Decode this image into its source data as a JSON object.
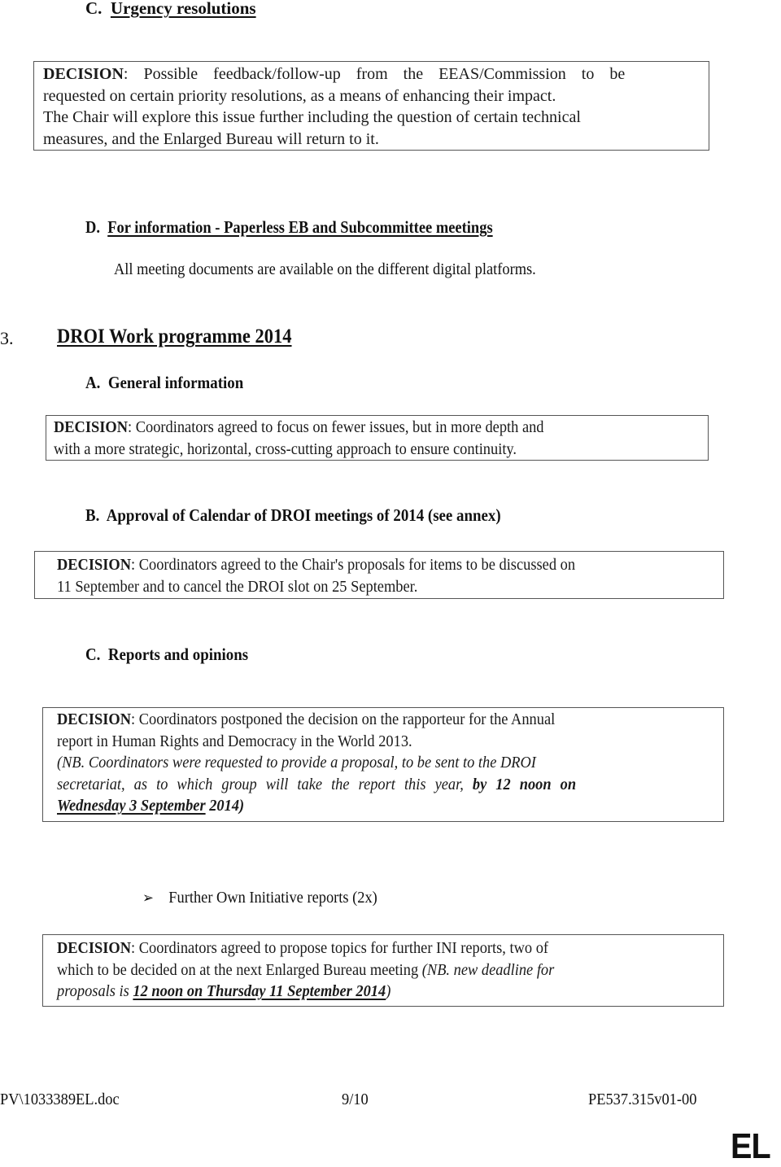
{
  "sections": {
    "urgency": {
      "letter": "C.",
      "title": "Urgency resolutions",
      "decision_label": "DECISION",
      "decision_lines": [
        ": Possible feedback/follow-up from the EEAS/Commission to be",
        "requested on certain priority resolutions, as a means of enhancing their impact.",
        "The Chair will explore this issue further including the question of certain technical",
        "measures, and the Enlarged Bureau will return to it."
      ]
    },
    "paperless": {
      "letter": "D.",
      "title": "For information - Paperless EB and Subcommittee meetings",
      "body": "All meeting documents are available on the different digital platforms."
    },
    "work_programme": {
      "number": "3.",
      "title": "DROI Work programme 2014",
      "general": {
        "letter": "A.",
        "title": "General information",
        "decision_label": "DECISION",
        "decision_lines": [
          ": Coordinators agreed to focus on fewer issues, but in more depth and",
          "with a more strategic, horizontal, cross-cutting approach to ensure continuity."
        ]
      },
      "calendar": {
        "letter": "B.",
        "title": "Approval of Calendar of DROI meetings of 2014 (see annex)",
        "decision_label": "DECISION",
        "decision_lines": [
          ": Coordinators agreed to the Chair's proposals for items to be discussed on",
          "11 September and to cancel the DROI slot on 25 September."
        ]
      },
      "reports": {
        "letter": "C.",
        "title": "Reports and opinions",
        "decision_label": "DECISION",
        "decision_line1": ": Coordinators postponed the decision on the rapporteur for the Annual",
        "decision_line2": "report in Human Rights and Democracy in the World 2013.",
        "nb_line1": "(NB. Coordinators were requested to provide a proposal, to be sent to the DROI",
        "nb_line2_a": "secretariat, as to which group will take the report this year, ",
        "nb_line2_b": "by 12 noon on",
        "nb_line3_a": "Wednesday 3 September",
        "nb_line3_b": " 2014)"
      },
      "ini": {
        "bullet_icon": "➢",
        "title": "Further Own Initiative reports (2x)",
        "decision_label": "DECISION",
        "decision_line1": ": Coordinators agreed to propose topics for further INI reports, two of",
        "decision_line2_a": "which to be decided on at the next Enlarged Bureau meeting ",
        "decision_line2_b": "(NB. new deadline for",
        "decision_line3_a": "proposals is ",
        "decision_line3_b": "12 noon on Thursday 11 September 2014",
        "decision_line3_c": ")"
      }
    }
  },
  "footer": {
    "doc_ref": "PV\\1033389EL.doc",
    "page": "9/10",
    "pe_ref": "PE537.315v01-00",
    "language": "EL"
  }
}
